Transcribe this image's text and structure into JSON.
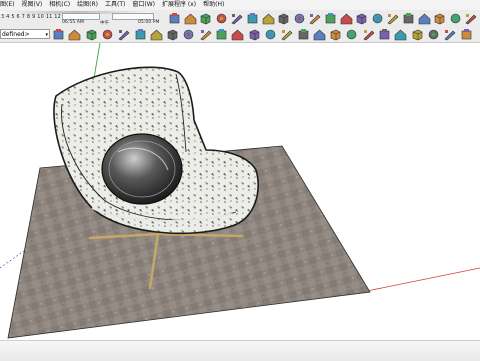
{
  "menu": [
    "图(E)",
    "视图(V)",
    "相机(C)",
    "绘图(R)",
    "工具(T)",
    "窗口(W)",
    "扩展程序 (x)",
    "帮助(H)"
  ],
  "shadow": {
    "month_numbers": "3 4 5 6 7 8 9 10 11 12",
    "time_start": "06:55 AM",
    "time_noon": "中午",
    "time_end": "05:00 PM"
  },
  "layer": {
    "selected": "defined>"
  },
  "colors": {
    "toolbar_bg": "#ececec",
    "floor": "#8a837d",
    "axis_red": "#d43a3a",
    "axis_green": "#3aa64a",
    "axis_blue": "#3b46cc"
  },
  "icons_row1": [
    "camera-icon",
    "film-icon",
    "home-icon",
    "house-icon",
    "house-outline-icon",
    "paste-icon",
    "box-icon",
    "bottle-icon",
    "cube-icon",
    "cube-blue-icon",
    "book-icon",
    "ring-icon",
    "link-icon",
    "warehouse-icon",
    "pencil-icon",
    "marker-icon",
    "eye-icon",
    "bucket-icon",
    "dropper-icon",
    "pin-icon"
  ],
  "icons_row2": [
    "folder-icon",
    "layers-icon",
    "shield-icon",
    "component-icon",
    "tree-icon",
    "move-icon",
    "rotate-icon",
    "cube-push-icon",
    "orbit-icon",
    "scissors-icon",
    "calendar-icon",
    "walk-icon",
    "page-icon",
    "film-frame-icon",
    "fill-icon",
    "layers2-icon",
    "select-icon",
    "blank-icon",
    "book2-icon",
    "graph-icon",
    "box2-icon",
    "shapes-icon",
    "tag-icon",
    "cube3-icon",
    "tool-icon",
    "cube4-icon"
  ]
}
